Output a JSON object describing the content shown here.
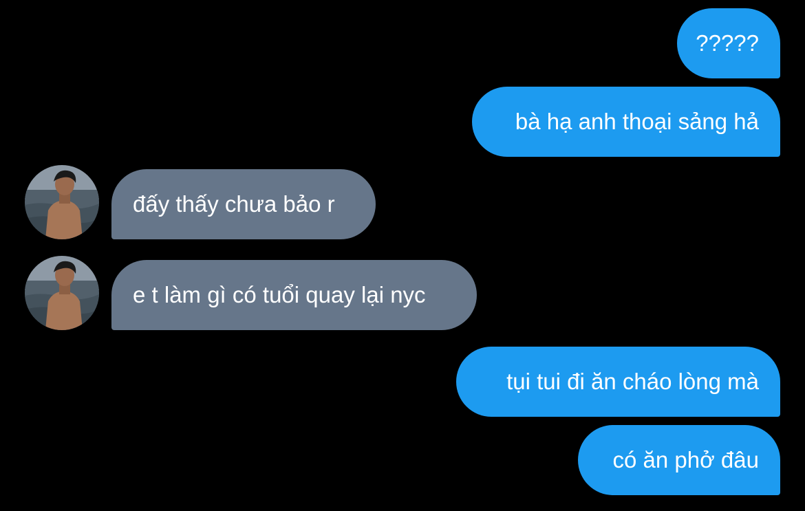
{
  "conversation": {
    "messages": [
      {
        "sender": "me",
        "text": "?????"
      },
      {
        "sender": "me",
        "text": "bà hạ anh thoại sảng hả"
      },
      {
        "sender": "other",
        "text": "đấy thấy chưa bảo r"
      },
      {
        "sender": "other",
        "text": "e t làm gì có tuổi quay lại nyc"
      },
      {
        "sender": "me",
        "text": "tụi tui đi ăn cháo lòng mà"
      },
      {
        "sender": "me",
        "text": "có ăn phở đâu"
      }
    ]
  },
  "colors": {
    "background": "#000000",
    "sent_bubble": "#1d9bf0",
    "received_bubble": "#66768a",
    "text": "#ffffff"
  }
}
